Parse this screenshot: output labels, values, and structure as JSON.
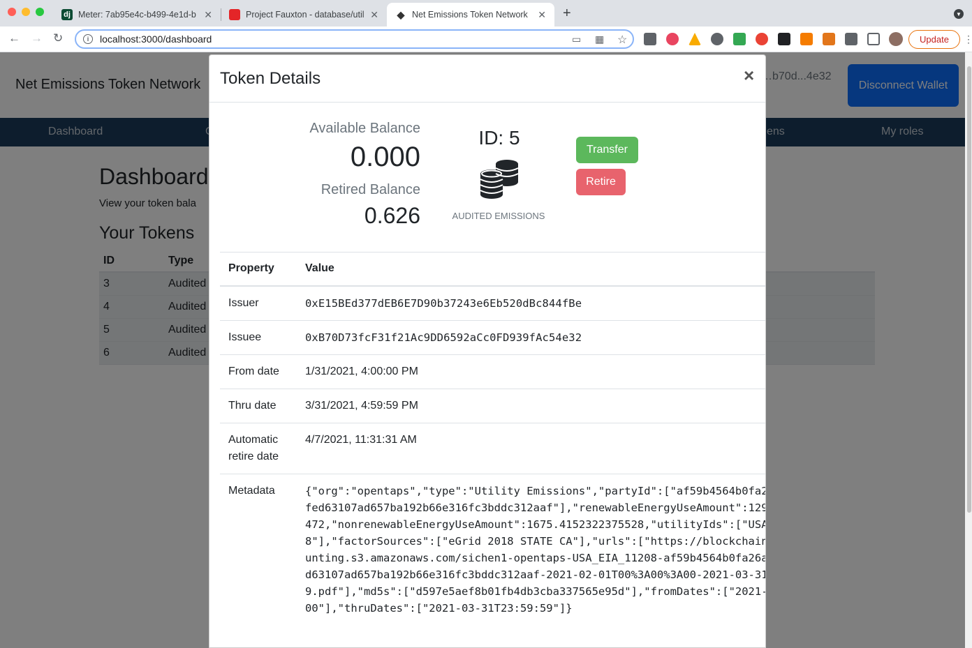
{
  "browser": {
    "tabs": [
      {
        "title": "Meter: 7ab95e4c-b499-4e1d-b",
        "favicon": "dj"
      },
      {
        "title": "Project Fauxton - database/util",
        "favicon": "couch"
      },
      {
        "title": "Net Emissions Token Network",
        "favicon": "eth"
      }
    ],
    "url": "localhost:3000/dashboard",
    "update_label": "Update"
  },
  "app": {
    "brand": "Net Emissions Token Network",
    "account_short": "…b70d...4e32",
    "disconnect_label": "Disconnect Wallet",
    "nav": {
      "dashboard": "Dashboard",
      "c": "C",
      "tokens": "ens",
      "my_roles": "My roles"
    },
    "dashboard_title": "Dashboard",
    "dashboard_sub": "View your token bala",
    "your_tokens": "Your Tokens",
    "table_headers": {
      "id": "ID",
      "type": "Type"
    },
    "rows": [
      {
        "id": "3",
        "type": "Audited"
      },
      {
        "id": "4",
        "type": "Audited"
      },
      {
        "id": "5",
        "type": "Audited"
      },
      {
        "id": "6",
        "type": "Audited"
      }
    ]
  },
  "modal": {
    "title": "Token Details",
    "close": "×",
    "available_balance_label": "Available Balance",
    "available_balance": "0.000",
    "retired_balance_label": "Retired Balance",
    "retired_balance": "0.626",
    "token_id": "ID: 5",
    "token_type": "AUDITED EMISSIONS",
    "transfer_label": "Transfer",
    "retire_label": "Retire",
    "table_headers": {
      "property": "Property",
      "value": "Value"
    },
    "properties": {
      "issuer": {
        "label": "Issuer",
        "value": "0xE15BEd377dEB6E7D90b37243e6Eb520dBc844fBe"
      },
      "issuee": {
        "label": "Issuee",
        "value": "0xB70D73fcF31f21Ac9DD6592aCc0FD939fAc54e32"
      },
      "from_date": {
        "label": "From date",
        "value": "1/31/2021, 4:00:00 PM"
      },
      "thru_date": {
        "label": "Thru date",
        "value": "3/31/2021, 4:59:59 PM"
      },
      "auto_retire": {
        "label": "Automatic retire date",
        "value": "4/7/2021, 11:31:31 AM"
      },
      "metadata": {
        "label": "Metadata",
        "value": "{\"org\":\"opentaps\",\"type\":\"Utility Emissions\",\"partyId\":[\"af59b4564b0fa26add10cbd378fed63107ad657ba192b66e316fc3bddc312aaf\"],\"renewableEnergyUseAmount\":1290.5847677624472,\"nonrenewableEnergyUseAmount\":1675.4152322375528,\"utilityIds\":[\"USA_EIA_11208\"],\"factorSources\":[\"eGrid 2018 STATE CA\"],\"urls\":[\"https://blockchain-carbon-accounting.s3.amazonaws.com/sichen1-opentaps-USA_EIA_11208-af59b4564b0fa26add10cbd378fed63107ad657ba192b66e316fc3bddc312aaf-2021-02-01T00%3A00%3A00-2021-03-31T23%3A59%3A59.pdf\"],\"md5s\":[\"d597e5aef8b01fb4db3cba337565e95d\"],\"fromDates\":[\"2021-02-01T00:00:00\"],\"thruDates\":[\"2021-03-31T23:59:59\"]}"
      }
    }
  }
}
